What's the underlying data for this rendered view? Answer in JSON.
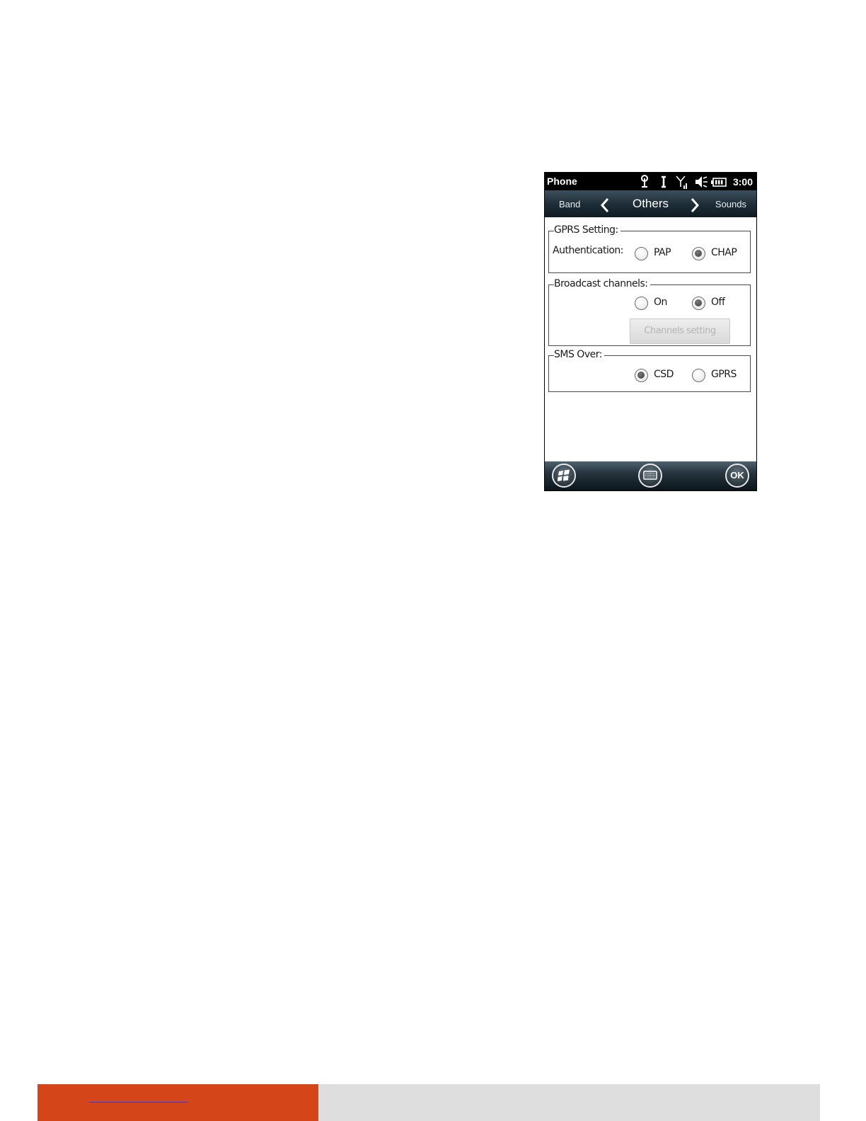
{
  "statusbar": {
    "app_title": "Phone",
    "time": "3:00",
    "icons": [
      "antenna-icon",
      "data-icon",
      "signal-icon",
      "speaker-muted-icon",
      "battery-icon"
    ]
  },
  "tabs": {
    "previous": "Band",
    "current": "Others",
    "next": "Sounds"
  },
  "gprs": {
    "legend": "GPRS Setting:",
    "auth_label": "Authentication:",
    "options": [
      {
        "label": "PAP",
        "checked": false
      },
      {
        "label": "CHAP",
        "checked": true
      }
    ]
  },
  "broadcast": {
    "legend": "Broadcast channels:",
    "options": [
      {
        "label": "On",
        "checked": false
      },
      {
        "label": "Off",
        "checked": true
      }
    ],
    "button_label": "Channels setting"
  },
  "sms": {
    "legend": "SMS Over:",
    "options": [
      {
        "label": "CSD",
        "checked": true
      },
      {
        "label": "GPRS",
        "checked": false
      }
    ]
  },
  "softkeys": {
    "ok_label": "OK"
  },
  "footer": {
    "accent_color": "#d4461a",
    "bar_color": "#dedede"
  }
}
